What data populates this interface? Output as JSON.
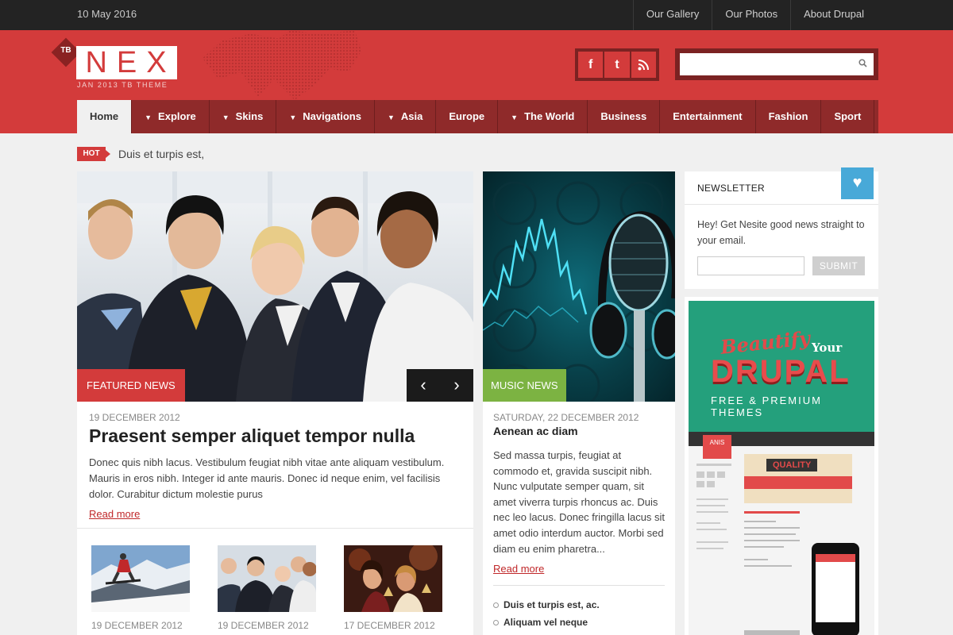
{
  "topbar": {
    "date": "10 May 2016",
    "links": [
      "Our Gallery",
      "Our Photos",
      "About Drupal"
    ]
  },
  "logo": {
    "badge": "TB",
    "name": "NEX",
    "tagline": "JAN 2013 TB THEME"
  },
  "social": {
    "facebook": "f",
    "twitter": "t",
    "rss": "rss-icon"
  },
  "search": {
    "value": "",
    "placeholder": ""
  },
  "nav": {
    "items": [
      {
        "label": "Home",
        "caret": false
      },
      {
        "label": "Explore",
        "caret": true
      },
      {
        "label": "Skins",
        "caret": true
      },
      {
        "label": "Navigations",
        "caret": true
      },
      {
        "label": "Asia",
        "caret": true
      },
      {
        "label": "Europe",
        "caret": false
      },
      {
        "label": "The World",
        "caret": true
      },
      {
        "label": "Business",
        "caret": false
      },
      {
        "label": "Entertainment",
        "caret": false
      },
      {
        "label": "Fashion",
        "caret": false
      },
      {
        "label": "Sport",
        "caret": false
      }
    ]
  },
  "hot": {
    "badge": "HOT",
    "text": "Duis et turpis est,"
  },
  "featured": {
    "label": "FEATURED NEWS",
    "prev": "‹",
    "next": "›",
    "date": "19 DECEMBER 2012",
    "title": "Praesent semper aliquet tempor nulla",
    "body": "Donec quis nibh lacus. Vestibulum feugiat nibh vitae ante aliquam vestibulum. Mauris in eros nibh. Integer id ante mauris. Donec id neque enim, vel facilisis dolor. Curabitur dictum molestie purus",
    "read_more": "Read more",
    "thumbs": [
      {
        "date": "19 DECEMBER 2012"
      },
      {
        "date": "19 DECEMBER 2012"
      },
      {
        "date": "17 DECEMBER 2012"
      }
    ]
  },
  "music": {
    "label": "MUSIC NEWS",
    "date": "SATURDAY, 22 DECEMBER 2012",
    "title": "Aenean ac diam",
    "body": "Sed massa turpis, feugiat at commodo et, gravida suscipit nibh. Nunc vulputate semper quam, sit amet viverra turpis rhoncus ac. Duis nec leo lacus. Donec fringilla lacus sit amet odio interdum auctor. Morbi sed diam eu enim pharetra...",
    "read_more": "Read more",
    "list": [
      "Duis et turpis est, ac.",
      "Aliquam vel neque"
    ]
  },
  "newsletter": {
    "title": "NEWSLETTER",
    "text": "Hey! Get Nesite good news straight to your email.",
    "email_value": "",
    "submit": "SUBMIT"
  },
  "ad": {
    "beautify": "Beautify",
    "your": "Your",
    "drupal": "DRUPAL",
    "subtitle": "FREE & PREMIUM THEMES",
    "screen_brand": "ANIS",
    "screen_quality": "QUALITY"
  },
  "colors": {
    "brand_red": "#d33b3b",
    "nav_dark": "#8f2a2a",
    "music_green": "#7cb342",
    "newsletter_blue": "#48a9d8"
  }
}
